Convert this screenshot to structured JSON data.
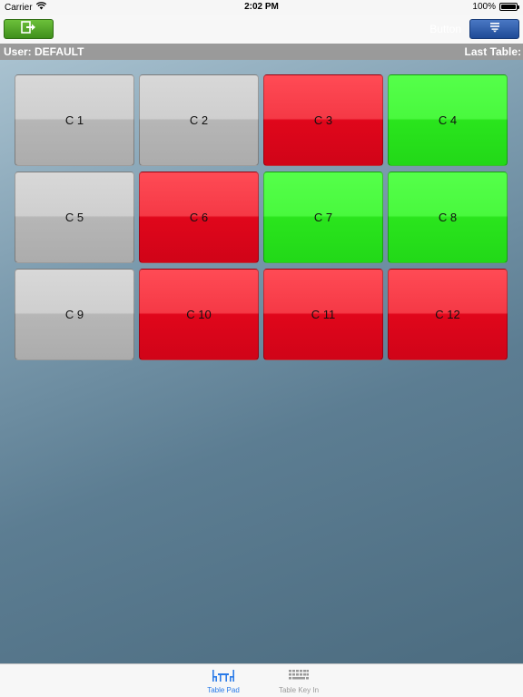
{
  "status": {
    "carrier": "Carrier",
    "time": "2:02 PM",
    "battery": "100%",
    "battery_level": 1.0
  },
  "nav": {
    "left_icon": "logout-icon",
    "right_icon": "menu-list-icon",
    "ghost_label": "Button",
    "left_color": "#4f9a27",
    "right_color": "#2a59a8"
  },
  "info": {
    "user": "User: DEFAULT",
    "last_table": "Last Table:"
  },
  "tables": [
    {
      "label": "C 1",
      "status": "gray"
    },
    {
      "label": "C 2",
      "status": "gray"
    },
    {
      "label": "C 3",
      "status": "red"
    },
    {
      "label": "C 4",
      "status": "green"
    },
    {
      "label": "C 5",
      "status": "gray"
    },
    {
      "label": "C 6",
      "status": "red"
    },
    {
      "label": "C 7",
      "status": "green"
    },
    {
      "label": "C 8",
      "status": "green"
    },
    {
      "label": "C 9",
      "status": "gray"
    },
    {
      "label": "C 10",
      "status": "red"
    },
    {
      "label": "C 11",
      "status": "red"
    },
    {
      "label": "C 12",
      "status": "red"
    }
  ],
  "tabs": [
    {
      "label": "Table Pad",
      "icon": "table-chairs-icon",
      "active": true
    },
    {
      "label": "Table Key In",
      "icon": "keyboard-icon",
      "active": false
    }
  ],
  "colors": {
    "gray_tile": "#c4c4c4",
    "red_tile": "#ee1c2c",
    "green_tile": "#3ef033",
    "active_tab": "#2a7be8"
  }
}
